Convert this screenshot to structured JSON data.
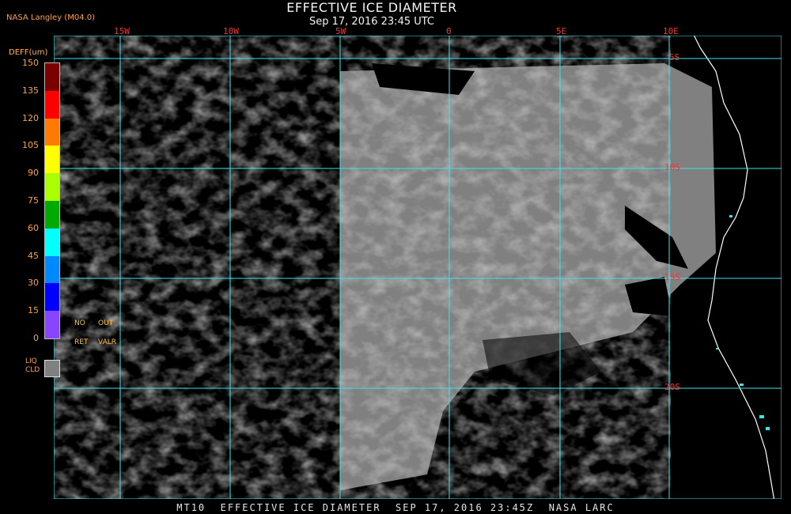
{
  "header": {
    "title": "EFFECTIVE ICE DIAMETER",
    "subtitle": "Sep 17, 2016 23:45 UTC",
    "source": "NASA Langley (M04.0)"
  },
  "legend": {
    "units_label": "DEFF(um)",
    "ticks": [
      "150",
      "135",
      "120",
      "105",
      "90",
      "75",
      "60",
      "45",
      "30",
      "15",
      "0"
    ],
    "colors": [
      "#7a0000",
      "#ff0000",
      "#ff7a00",
      "#ffff00",
      "#aaff00",
      "#00aa00",
      "#00ffff",
      "#0088ff",
      "#0000ff",
      "#8844ff"
    ],
    "flags": [
      "NO",
      "OUT",
      "RET",
      "VALR"
    ],
    "liquid_cloud_label": "LIQ CLD",
    "liquid_cloud_color": "#808080"
  },
  "map": {
    "lon_labels": [
      "15W",
      "10W",
      "5W",
      "0",
      "5E",
      "10E"
    ],
    "lat_labels": [
      "5S",
      "10S",
      "15S",
      "20S"
    ],
    "cloud_color": "#808080",
    "grid_color": "#40e0e8",
    "coast_color": "#ffffff"
  },
  "footer": "MT10  EFFECTIVE ICE DIAMETER  SEP 17, 2016 23:45Z  NASA LARC"
}
